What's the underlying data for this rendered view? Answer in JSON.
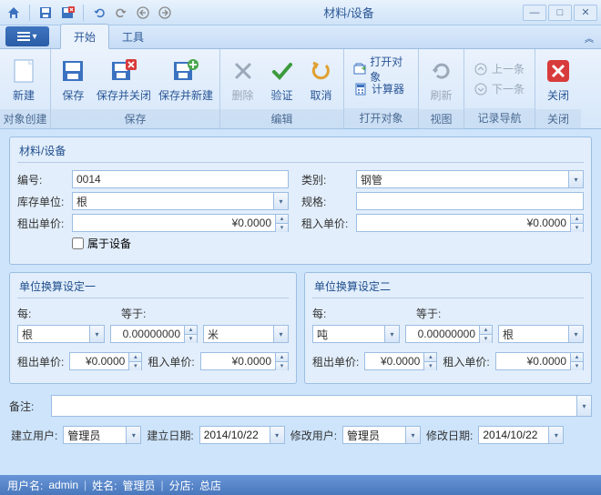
{
  "window": {
    "title": "材料/设备"
  },
  "tabs": {
    "start": "开始",
    "tools": "工具"
  },
  "ribbon": {
    "groups": {
      "create": {
        "label": "对象创建",
        "new": "新建"
      },
      "save": {
        "label": "保存",
        "save": "保存",
        "save_close": "保存并关闭",
        "save_new": "保存并新建"
      },
      "edit": {
        "label": "编辑",
        "delete": "删除",
        "validate": "验证",
        "cancel": "取消"
      },
      "open": {
        "label": "打开对象",
        "open_obj": "打开对象",
        "calc": "计算器"
      },
      "view": {
        "label": "视图",
        "refresh": "刷新"
      },
      "nav": {
        "label": "记录导航",
        "prev": "上一条",
        "next": "下一条"
      },
      "close": {
        "label": "关闭",
        "close": "关闭"
      }
    }
  },
  "form": {
    "panel1_title": "材料/设备",
    "number_lbl": "编号:",
    "number": "0014",
    "category_lbl": "类别:",
    "category": "钢管",
    "stock_unit_lbl": "库存单位:",
    "stock_unit": "根",
    "spec_lbl": "规格:",
    "spec": "",
    "rent_out_price_lbl": "租出单价:",
    "rent_out_price": "¥0.0000",
    "rent_in_price_lbl": "租入单价:",
    "rent_in_price": "¥0.0000",
    "is_equipment_lbl": "属于设备",
    "conv1_title": "单位换算设定一",
    "conv2_title": "单位换算设定二",
    "per_lbl": "每:",
    "eq_lbl": "等于:",
    "conv1_unit_from": "根",
    "conv1_factor": "0.00000000",
    "conv1_unit_to": "米",
    "conv2_unit_from": "吨",
    "conv2_factor": "0.00000000",
    "conv2_unit_to": "根",
    "c_rent_out_lbl": "租出单价:",
    "c_rent_in_lbl": "租入单价:",
    "c1_rent_out": "¥0.0000",
    "c1_rent_in": "¥0.0000",
    "c2_rent_out": "¥0.0000",
    "c2_rent_in": "¥0.0000",
    "remark_lbl": "备注:",
    "remark": "",
    "create_user_lbl": "建立用户:",
    "create_user": "管理员",
    "create_date_lbl": "建立日期:",
    "create_date": "2014/10/22",
    "modify_user_lbl": "修改用户:",
    "modify_user": "管理员",
    "modify_date_lbl": "修改日期:",
    "modify_date": "2014/10/22"
  },
  "status": {
    "user_lbl": "用户名:",
    "user": "admin",
    "name_lbl": "姓名:",
    "name": "管理员",
    "branch_lbl": "分店:",
    "branch": "总店"
  }
}
